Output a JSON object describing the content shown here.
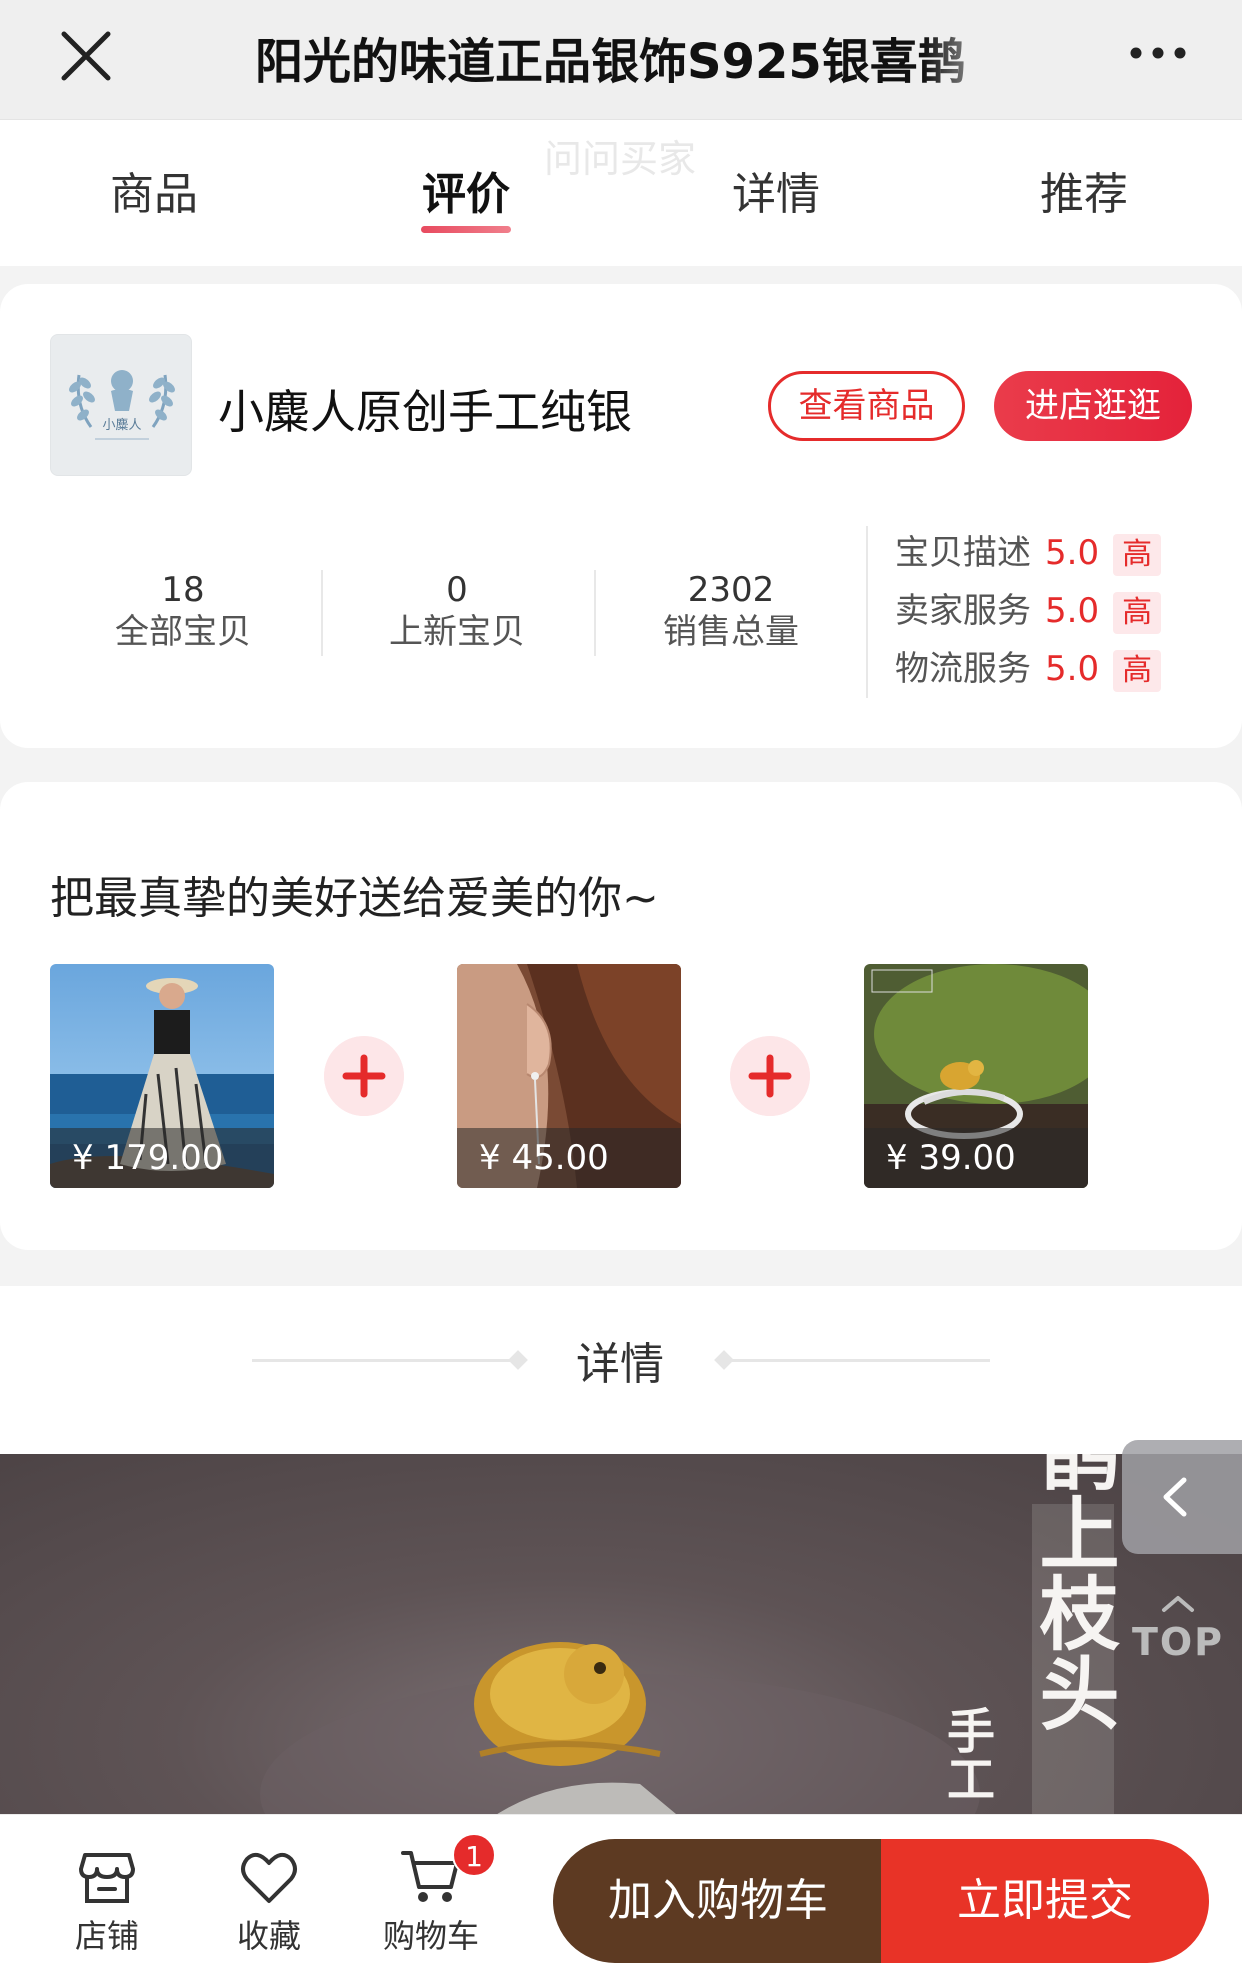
{
  "navbar": {
    "title": "阳光的味道正品银饰S925银喜鹊"
  },
  "tabs": {
    "overlay_hint": "问问买家",
    "items": [
      "商品",
      "评价",
      "详情",
      "推荐"
    ],
    "active": "评价"
  },
  "shop": {
    "name": "小麋人原创手工纯银",
    "view_button": "查看商品",
    "enter_button": "进店逛逛",
    "logo_text": "小麋人",
    "stats": [
      {
        "value": "18",
        "label": "全部宝贝"
      },
      {
        "value": "0",
        "label": "上新宝贝"
      },
      {
        "value": "2302",
        "label": "销售总量"
      }
    ],
    "ratings": [
      {
        "label": "宝贝描述",
        "score": "5.0",
        "level": "高"
      },
      {
        "label": "卖家服务",
        "score": "5.0",
        "level": "高"
      },
      {
        "label": "物流服务",
        "score": "5.0",
        "level": "高"
      }
    ]
  },
  "combo": {
    "title": "把最真挚的美好送给爱美的你~",
    "items": [
      {
        "price": "¥ 179.00",
        "image": "woman-seaside-dress"
      },
      {
        "price": "¥ 45.00",
        "image": "ear-earring"
      },
      {
        "price": "¥ 39.00",
        "image": "bird-ring"
      }
    ]
  },
  "detail": {
    "title": "详情",
    "banner_text": "鹊上枝头",
    "banner_side_text": "手工"
  },
  "floating": {
    "top_label": "TOP"
  },
  "bottombar": {
    "shop_label": "店铺",
    "fav_label": "收藏",
    "cart_label": "购物车",
    "cart_count": "1",
    "add_to_cart": "加入购物车",
    "submit": "立即提交"
  },
  "colors": {
    "accent_red": "#e52b2b",
    "cart_brown": "#5d3a22",
    "submit_red": "#e83327"
  }
}
